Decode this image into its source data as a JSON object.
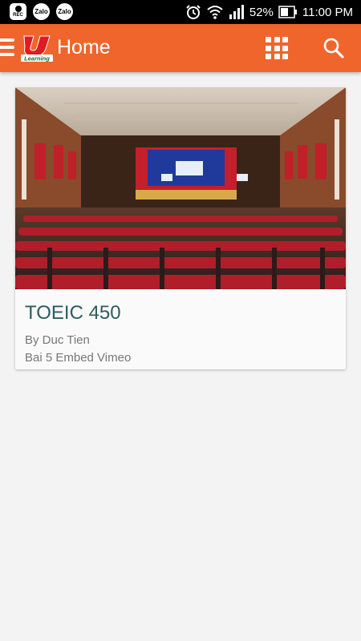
{
  "status_bar": {
    "rec_label": "REC",
    "zalo_label_1": "Zalo",
    "zalo_label_2": "Zalo",
    "battery_percent": "52%",
    "time": "11:00 PM"
  },
  "app_bar": {
    "logo_text": "Learning",
    "title": "Home",
    "accent_color": "#f0652c"
  },
  "course_card": {
    "title": "TOEIC 450",
    "author": "By Duc Tien",
    "lesson": "Bai 5 Embed Vimeo"
  }
}
